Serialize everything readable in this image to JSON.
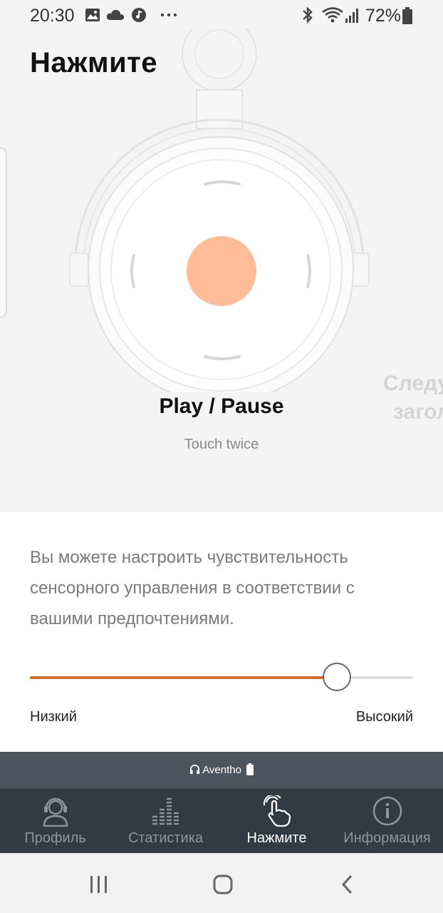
{
  "status_bar": {
    "time": "20:30",
    "battery_percent": "72%"
  },
  "page": {
    "title": "Нажмите"
  },
  "gesture": {
    "name": "Play / Pause",
    "hint": "Touch twice",
    "next_peek_line1": "Следу",
    "next_peek_line2": "загол"
  },
  "sensitivity": {
    "description": "Вы можете настроить чувствительность сенсорного управления в соответствии с вашими предпочтениями.",
    "value_fraction": 0.802,
    "low_label": "Низкий",
    "high_label": "Высокий",
    "accent_color": "#dc6a2c"
  },
  "device": {
    "name": "Aventho",
    "icon": "headphones-icon"
  },
  "tabs": [
    {
      "label": "Профиль",
      "icon": "profile-headset-icon",
      "active": false
    },
    {
      "label": "Статистика",
      "icon": "equalizer-icon",
      "active": false
    },
    {
      "label": "Нажмите",
      "icon": "touch-hand-icon",
      "active": true
    },
    {
      "label": "Информация",
      "icon": "info-icon",
      "active": false
    }
  ],
  "colors": {
    "tap_dot": "#ffbc98",
    "nav_bg": "#323a43",
    "device_bar_bg": "#4b555f",
    "active_tab_text": "#ffffff",
    "inactive_tab_text": "#8d959d"
  }
}
